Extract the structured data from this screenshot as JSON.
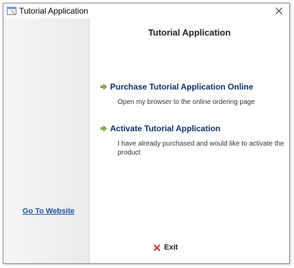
{
  "window": {
    "title": "Tutorial Application",
    "icons": {
      "app": "app-window-icon",
      "close": "close-icon"
    }
  },
  "sidebar": {
    "link_label": "Go To Website",
    "link_color": "#1a53a8"
  },
  "main": {
    "title": "Tutorial Application",
    "options": [
      {
        "label": "Purchase Tutorial Application Online",
        "description": "Open my browser to the online ordering page",
        "icon": "green-arrow-icon"
      },
      {
        "label": "Activate Tutorial Application",
        "description": "I have already purchased and would like to activate the product",
        "icon": "green-arrow-icon"
      }
    ],
    "exit": {
      "label": "Exit",
      "icon": "red-x-icon"
    }
  },
  "colors": {
    "arrow_green": "#7fb83a",
    "exit_red": "#d9352b",
    "option_title": "#0f2f6e"
  }
}
